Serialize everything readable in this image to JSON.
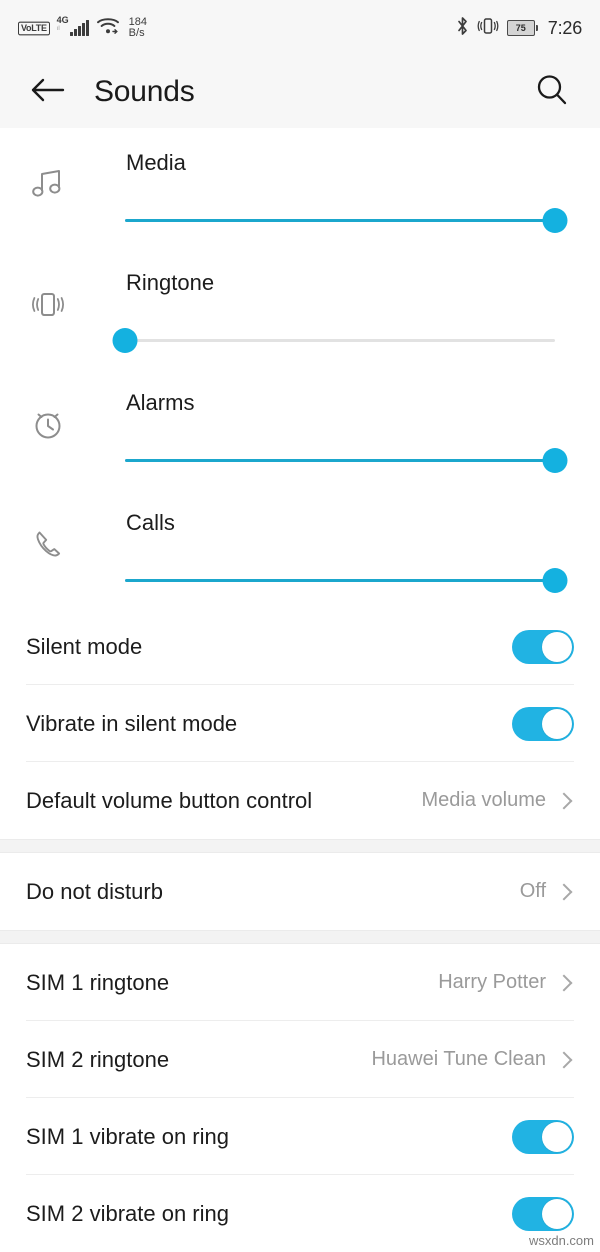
{
  "status_bar": {
    "volte_label": "VoLTE",
    "network_type": "4G",
    "network_sub": "ıl",
    "data_speed_value": "184",
    "data_speed_unit": "B/s",
    "bluetooth_icon": "bluetooth-icon",
    "vibrate_icon": "vibrate-icon",
    "battery_percent": "75",
    "time": "7:26"
  },
  "app_bar": {
    "back_icon": "back-arrow-icon",
    "title": "Sounds",
    "search_icon": "search-icon"
  },
  "volume_sliders": [
    {
      "label": "Media",
      "icon": "music-note-icon",
      "value": 100
    },
    {
      "label": "Ringtone",
      "icon": "vibrate-icon",
      "value": 0
    },
    {
      "label": "Alarms",
      "icon": "alarm-clock-icon",
      "value": 100
    },
    {
      "label": "Calls",
      "icon": "phone-icon",
      "value": 100
    }
  ],
  "settings_group_1": [
    {
      "label": "Silent mode",
      "type": "toggle",
      "value": "on"
    },
    {
      "label": "Vibrate in silent mode",
      "type": "toggle",
      "value": "on"
    },
    {
      "label": "Default volume button control",
      "type": "link",
      "value": "Media volume"
    }
  ],
  "settings_group_2": [
    {
      "label": "Do not disturb",
      "type": "link",
      "value": "Off"
    }
  ],
  "settings_group_3": [
    {
      "label": "SIM 1 ringtone",
      "type": "link",
      "value": "Harry Potter"
    },
    {
      "label": "SIM 2 ringtone",
      "type": "link",
      "value": "Huawei Tune Clean"
    },
    {
      "label": "SIM 1 vibrate on ring",
      "type": "toggle",
      "value": "on"
    },
    {
      "label": "SIM 2 vibrate on ring",
      "type": "toggle",
      "value": "on"
    }
  ],
  "watermark": "wsxdn.com",
  "colors": {
    "accent": "#21b3e3",
    "slider_fill": "#1ba7cd",
    "header_bg": "#f7f7f7",
    "value_text": "#9a9a9a"
  }
}
